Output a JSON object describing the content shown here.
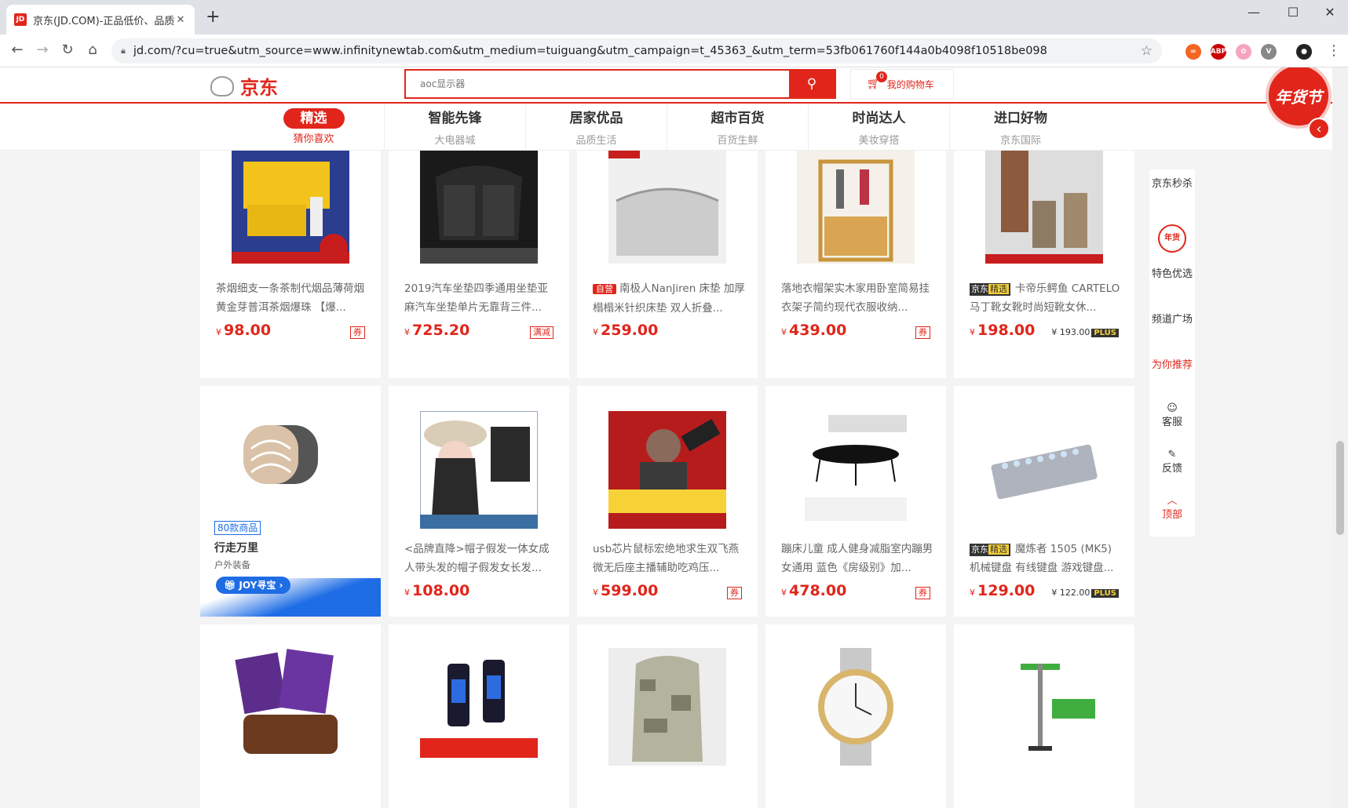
{
  "browser": {
    "tab_title": "京东(JD.COM)-正品低价、品质",
    "favicon": "JD",
    "url": "jd.com/?cu=true&utm_source=www.infinitynewtab.com&utm_medium=tuiguang&utm_campaign=t_45363_&utm_term=53fb061760f144a0b4098f10518be098"
  },
  "header": {
    "logo": "京东",
    "search_placeholder": "aoc显示器",
    "cart_label": "我的购物车",
    "cart_count": "0",
    "festival_badge": "年货节"
  },
  "categories": [
    {
      "title": "精选",
      "sub": "猜你喜欢"
    },
    {
      "title": "智能先锋",
      "sub": "大电器城"
    },
    {
      "title": "居家优品",
      "sub": "品质生活"
    },
    {
      "title": "超市百货",
      "sub": "百货生鲜"
    },
    {
      "title": "时尚达人",
      "sub": "美妆穿搭"
    },
    {
      "title": "进口好物",
      "sub": "京东国际"
    }
  ],
  "products": [
    {
      "name": "茶烟细支一条茶制代烟品薄荷烟黄金芽普洱茶烟爆珠 【爆...",
      "price": "98.00",
      "tag": "券"
    },
    {
      "name": "2019汽车坐垫四季通用坐垫亚麻汽车坐垫单片无靠背三件...",
      "price": "725.20",
      "tag": "满减"
    },
    {
      "name": "南极人NanJiren 床垫 加厚榻榻米针织床垫 双人折叠...",
      "price": "259.00",
      "tag": "",
      "ziying": "自营"
    },
    {
      "name": "落地衣帽架实木家用卧室简易挂衣架子简约现代衣服收纳...",
      "price": "439.00",
      "tag": "券"
    },
    {
      "name": "卡帝乐鳄鱼 CARTELO 马丁靴女靴时尚短靴女休...",
      "price": "198.00",
      "plus": "193.00",
      "jx": true
    },
    {
      "name": "<品牌直降>帽子假发一体女成人带头发的帽子假发女长发...",
      "price": "108.00",
      "tag": ""
    },
    {
      "name": "usb芯片鼠标宏绝地求生双飞燕微无后座主播辅助吃鸡压...",
      "price": "599.00",
      "tag": "券"
    },
    {
      "name": "蹦床儿童 成人健身减脂室内蹦男女通用 蓝色《房级别》加...",
      "price": "478.00",
      "tag": "券"
    },
    {
      "name": "魔炼者 1505 (MK5) 机械键盘 有线键盘 游戏键盘...",
      "price": "129.00",
      "plus": "122.00",
      "jx": true
    }
  ],
  "promo": {
    "badge": "80款商品",
    "title": "行走万里",
    "sub": "户外装备",
    "btn": "JOY寻宝"
  },
  "jx_label": {
    "a": "京东",
    "b": "精选"
  },
  "plus_label": "PLUS",
  "currency": "¥",
  "sidebar": [
    {
      "label": "京东秒杀"
    },
    {
      "label": "年货节"
    },
    {
      "label": "特色优选"
    },
    {
      "label": "频道广场"
    },
    {
      "label": "为你推荐"
    },
    {
      "label": "客服"
    },
    {
      "label": "反馈"
    },
    {
      "label": "顶部"
    }
  ],
  "colors": {
    "brand": "#e1251b"
  }
}
